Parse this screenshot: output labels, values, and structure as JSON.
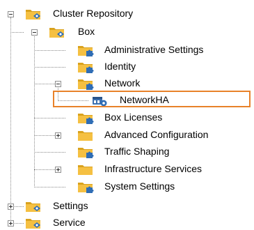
{
  "tree": {
    "root": {
      "label": "Cluster Repository",
      "icon": "folder-gear-icon",
      "expanded": true,
      "children": [
        {
          "label": "Box",
          "icon": "folder-gear-icon",
          "expanded": true,
          "children": [
            {
              "label": "Administrative Settings",
              "icon": "folder-puzzle-icon"
            },
            {
              "label": "Identity",
              "icon": "folder-puzzle-icon"
            },
            {
              "label": "Network",
              "icon": "folder-puzzle-icon",
              "expanded": true,
              "children": [
                {
                  "label": "NetworkHA",
                  "icon": "network-config-icon",
                  "selected": true
                }
              ]
            },
            {
              "label": "Box Licenses",
              "icon": "folder-puzzle-icon"
            },
            {
              "label": "Advanced Configuration",
              "icon": "folder-icon",
              "expanded": false
            },
            {
              "label": "Traffic Shaping",
              "icon": "folder-puzzle-icon"
            },
            {
              "label": "Infrastructure Services",
              "icon": "folder-icon",
              "expanded": false
            },
            {
              "label": "System Settings",
              "icon": "folder-puzzle-icon"
            }
          ]
        },
        {
          "label": "Settings",
          "icon": "folder-gear-icon",
          "expanded": false
        },
        {
          "label": "Service",
          "icon": "folder-gear-icon",
          "expanded": false
        }
      ]
    }
  },
  "colors": {
    "folder": "#f5c042",
    "folder_dark": "#d9a21e",
    "badge_blue": "#2f6db5",
    "selection_outline": "#e8822a",
    "tree_line": "#8a8a8a"
  }
}
